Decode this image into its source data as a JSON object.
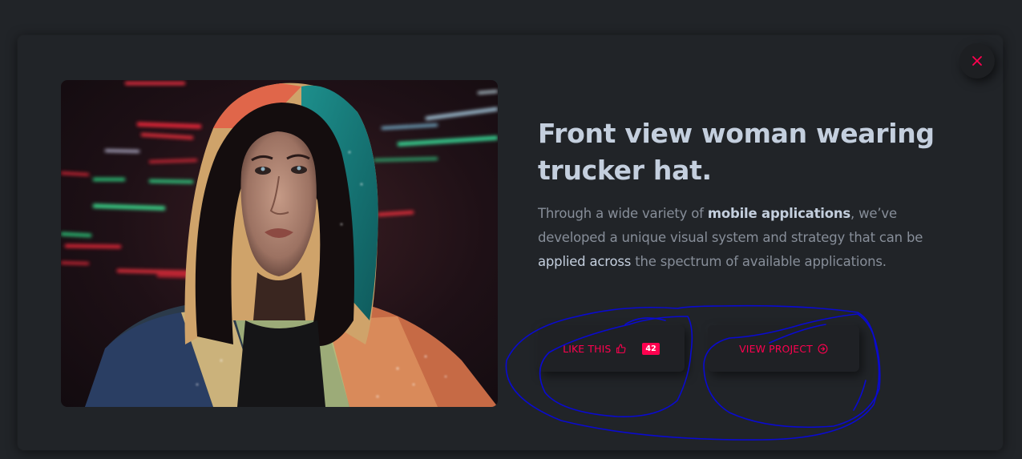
{
  "modal": {
    "close_icon": "close-icon"
  },
  "project": {
    "title_line1": "Front view woman wearing",
    "title_line2": "trucker hat.",
    "desc_part1": "Through a wide variety of ",
    "desc_bold": "mobile applications",
    "desc_part2": ", we’ve developed a unique visual system and strategy that can be ",
    "desc_highlight": "applied across",
    "desc_part3": " the spectrum of available applications.",
    "image_icon": "photo-woman-hood-neon"
  },
  "actions": {
    "like_label": "LIKE THIS",
    "like_icon": "thumbs-up-icon",
    "like_count": "42",
    "view_label": "VIEW PROJECT",
    "view_icon": "arrow-circle-right-icon"
  },
  "colors": {
    "background": "#212428",
    "accent": "#ff014f",
    "heading": "#c4cfde",
    "body_text": "#878e99",
    "annotation_ink": "#0a0ad0"
  }
}
